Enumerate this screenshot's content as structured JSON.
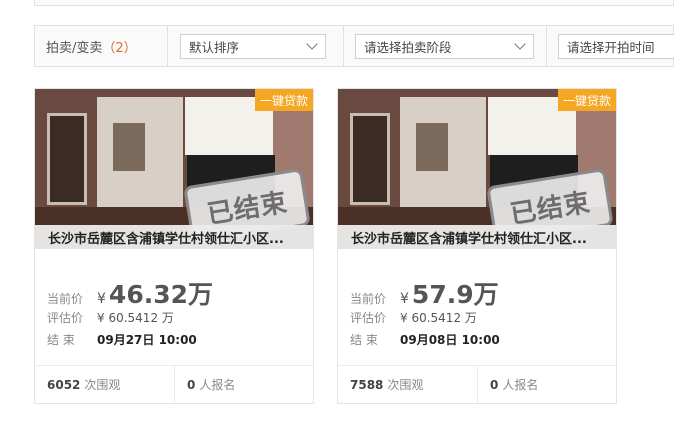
{
  "filter": {
    "title": "拍卖/变卖",
    "count": "（2）",
    "sort": "默认排序",
    "stage": "请选择拍卖阶段",
    "time": "请选择开拍时间"
  },
  "colors": {
    "accent_tag": "#f5a623",
    "count": "#e06a2a"
  },
  "cards": [
    {
      "tag": "一键贷款",
      "stamp": "已结束",
      "title": "长沙市岳麓区含浦镇学仕村领仕汇小区...",
      "current_label": "当前价",
      "yen": "¥",
      "price": "46.32万",
      "appraisal_label": "评估价",
      "appraisal": "¥ 60.5412 万",
      "end_label": "结 束",
      "end": "09月27日 10:00",
      "views": "6052",
      "views_label": "次围观",
      "signups": "0",
      "signups_label": "人报名"
    },
    {
      "tag": "一键贷款",
      "stamp": "已结束",
      "title": "长沙市岳麓区含浦镇学仕村领仕汇小区...",
      "current_label": "当前价",
      "yen": "¥",
      "price": "57.9万",
      "appraisal_label": "评估价",
      "appraisal": "¥ 60.5412 万",
      "end_label": "结 束",
      "end": "09月08日 10:00",
      "views": "7588",
      "views_label": "次围观",
      "signups": "0",
      "signups_label": "人报名"
    }
  ]
}
